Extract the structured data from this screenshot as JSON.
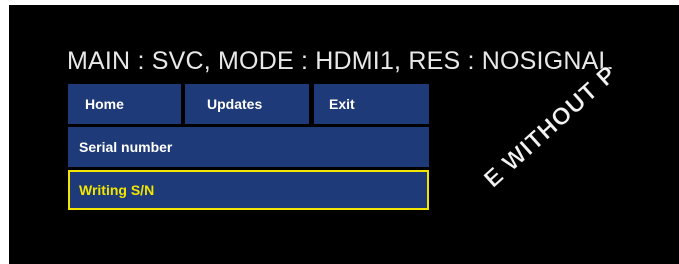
{
  "status_line": "MAIN : SVC, MODE : HDMI1, RES : NOSIGNAL",
  "menu": {
    "home": "Home",
    "updates": "Updates",
    "exit": "Exit",
    "serial_number": "Serial number",
    "writing_sn": "Writing S/N"
  },
  "watermark": "E WITHOUT P",
  "colors": {
    "background": "#000000",
    "button": "#1f3a78",
    "selected_border": "#f2e600",
    "selected_text": "#f2e600"
  }
}
